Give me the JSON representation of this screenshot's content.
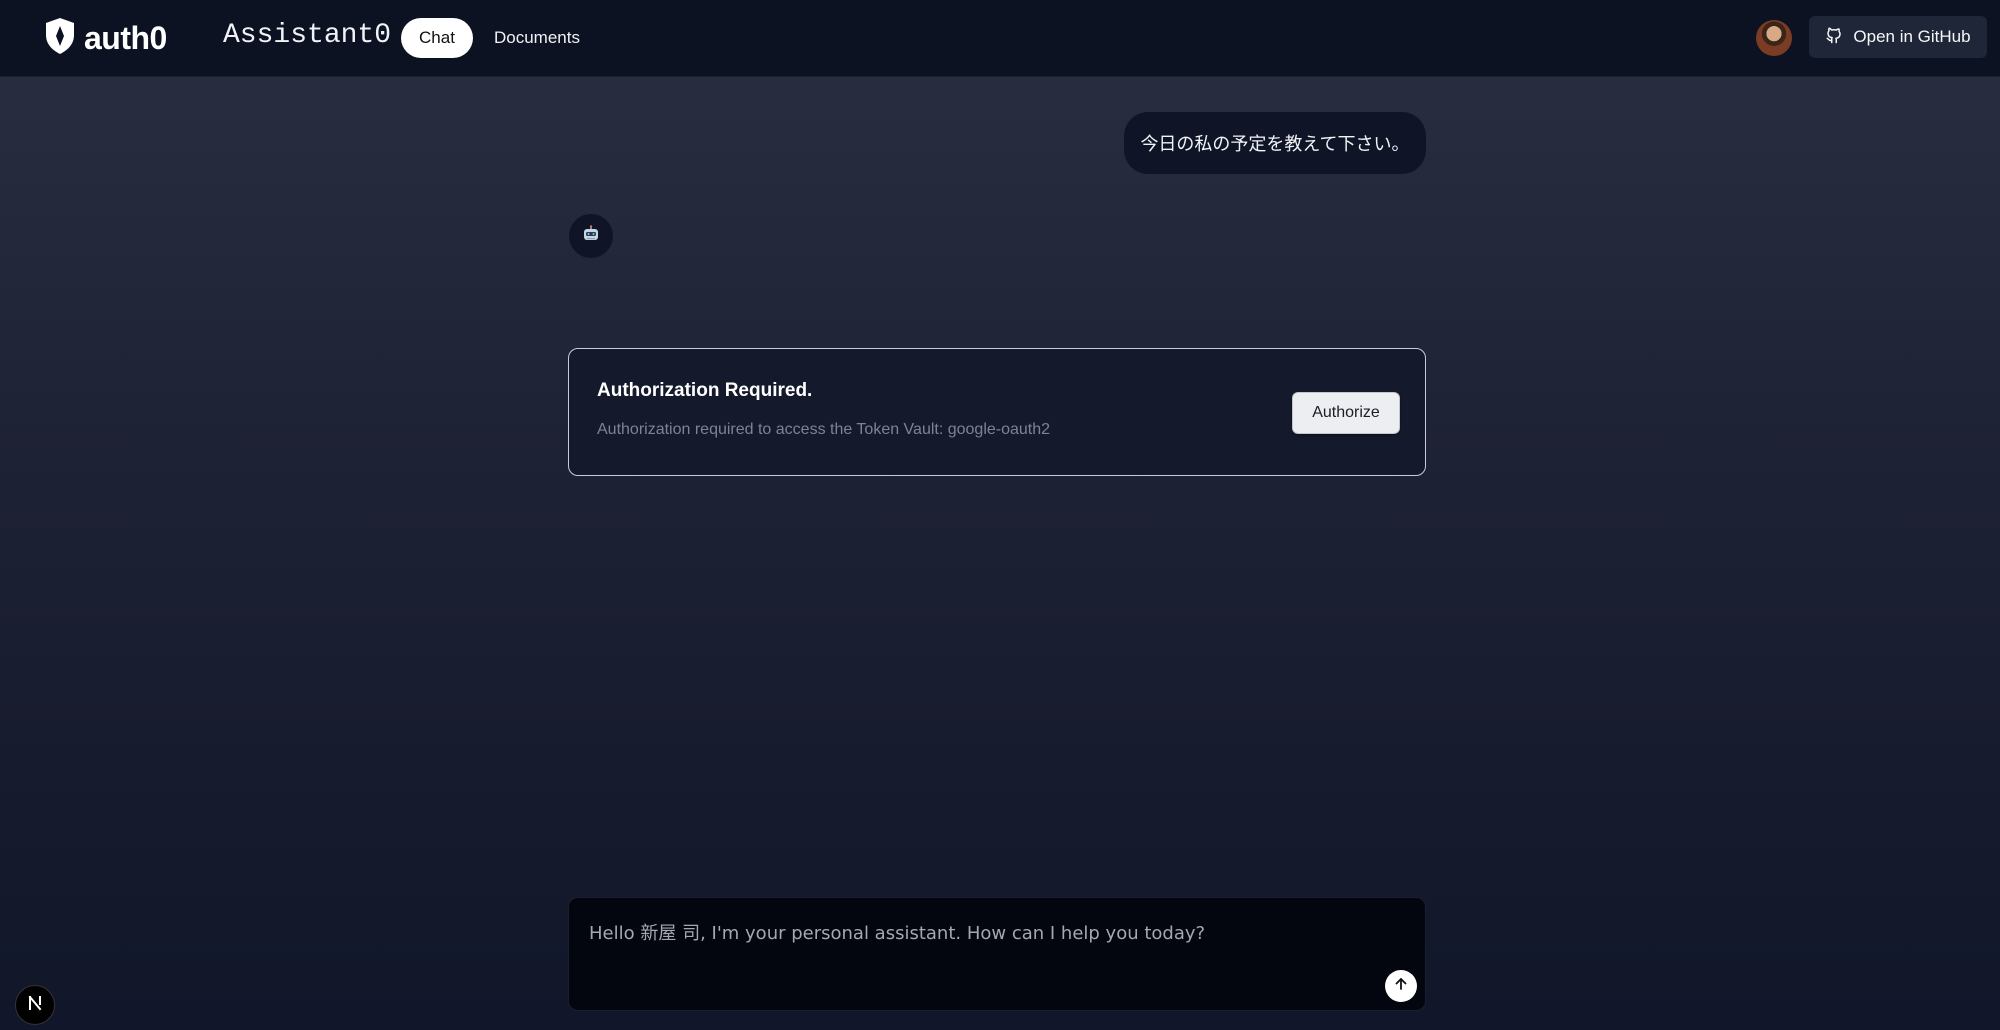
{
  "header": {
    "logo_text": "auth0",
    "app_title": "Assistant0",
    "nav": {
      "chat_label": "Chat",
      "documents_label": "Documents"
    },
    "github_label": "Open in GitHub"
  },
  "conversation": {
    "user_message": "今日の私の予定を教えて下さい。",
    "bot_avatar_icon": "robot-icon"
  },
  "auth_card": {
    "title": "Authorization Required.",
    "description": "Authorization required to access the Token Vault: google-oauth2",
    "button_label": "Authorize"
  },
  "composer": {
    "placeholder": "Hello 新屋 司, I'm your personal assistant. How can I help you today?",
    "value": ""
  },
  "badge": {
    "icon": "nextjs-icon",
    "letter": "N"
  },
  "colors": {
    "topbar": "#0c1222",
    "card_border": "#c9ccd6",
    "composer_bg": "#03060f"
  }
}
